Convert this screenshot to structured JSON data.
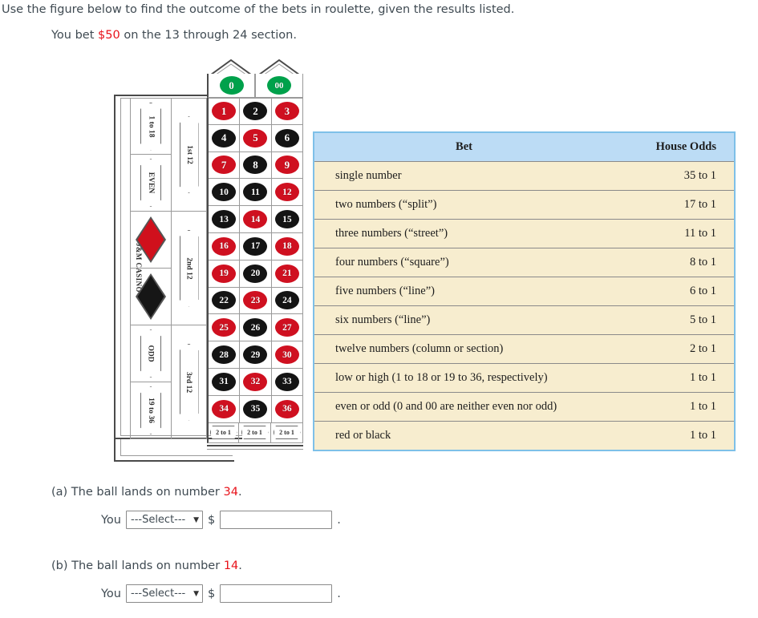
{
  "prompt": {
    "instruction": "Use the figure below to find the outcome of the bets in roulette, given the results listed.",
    "bet_prefix": "You bet ",
    "bet_amount": "$50",
    "bet_suffix": " on the 13 through 24 section.",
    "amount_color": "#e8121a"
  },
  "roulette": {
    "casino_name": "J&M CASINO",
    "zeros": [
      {
        "label": "0",
        "color": "green"
      },
      {
        "label": "00",
        "color": "green"
      }
    ],
    "numbers": [
      {
        "n": "1",
        "color": "red"
      },
      {
        "n": "2",
        "color": "black"
      },
      {
        "n": "3",
        "color": "red"
      },
      {
        "n": "4",
        "color": "black"
      },
      {
        "n": "5",
        "color": "red"
      },
      {
        "n": "6",
        "color": "black"
      },
      {
        "n": "7",
        "color": "red"
      },
      {
        "n": "8",
        "color": "black"
      },
      {
        "n": "9",
        "color": "red"
      },
      {
        "n": "10",
        "color": "black"
      },
      {
        "n": "11",
        "color": "black"
      },
      {
        "n": "12",
        "color": "red"
      },
      {
        "n": "13",
        "color": "black"
      },
      {
        "n": "14",
        "color": "red"
      },
      {
        "n": "15",
        "color": "black"
      },
      {
        "n": "16",
        "color": "red"
      },
      {
        "n": "17",
        "color": "black"
      },
      {
        "n": "18",
        "color": "red"
      },
      {
        "n": "19",
        "color": "red"
      },
      {
        "n": "20",
        "color": "black"
      },
      {
        "n": "21",
        "color": "red"
      },
      {
        "n": "22",
        "color": "black"
      },
      {
        "n": "23",
        "color": "red"
      },
      {
        "n": "24",
        "color": "black"
      },
      {
        "n": "25",
        "color": "red"
      },
      {
        "n": "26",
        "color": "black"
      },
      {
        "n": "27",
        "color": "red"
      },
      {
        "n": "28",
        "color": "black"
      },
      {
        "n": "29",
        "color": "black"
      },
      {
        "n": "30",
        "color": "red"
      },
      {
        "n": "31",
        "color": "black"
      },
      {
        "n": "32",
        "color": "red"
      },
      {
        "n": "33",
        "color": "black"
      },
      {
        "n": "34",
        "color": "red"
      },
      {
        "n": "35",
        "color": "black"
      },
      {
        "n": "36",
        "color": "red"
      }
    ],
    "outside_bets": [
      {
        "label": "1 to 18",
        "kind": "text"
      },
      {
        "label": "EVEN",
        "kind": "text"
      },
      {
        "label": "red",
        "kind": "diamond-red"
      },
      {
        "label": "black",
        "kind": "diamond-black"
      },
      {
        "label": "ODD",
        "kind": "text"
      },
      {
        "label": "19 to 36",
        "kind": "text"
      }
    ],
    "dozens": [
      "1st 12",
      "2nd 12",
      "3rd 12"
    ],
    "column_bets": [
      "2 to 1",
      "2 to 1",
      "2 to 1"
    ],
    "colors": {
      "red": "#cf1020",
      "black": "#141414",
      "green": "#00a14b"
    }
  },
  "odds_table": {
    "headers": {
      "bet": "Bet",
      "odds": "House Odds"
    },
    "header_bg": "#bcdcf5",
    "body_bg": "#f7edcf",
    "border": "#7ec0e8",
    "rows": [
      {
        "bet": "single number",
        "odds": "35 to 1"
      },
      {
        "bet": "two numbers (“split”)",
        "odds": "17 to 1"
      },
      {
        "bet": "three numbers (“street”)",
        "odds": "11 to 1"
      },
      {
        "bet": "four numbers (“square”)",
        "odds": "8 to 1"
      },
      {
        "bet": "five numbers (“line”)",
        "odds": "6 to 1"
      },
      {
        "bet": "six numbers (“line”)",
        "odds": "5 to 1"
      },
      {
        "bet": "twelve numbers (column or section)",
        "odds": "2 to 1"
      },
      {
        "bet": "low or high (1 to 18 or 19 to 36, respectively)",
        "odds": "1 to 1"
      },
      {
        "bet": "even or odd (0 and 00 are neither even nor odd)",
        "odds": "1 to 1"
      },
      {
        "bet": "red or black",
        "odds": "1 to 1"
      }
    ]
  },
  "questions": [
    {
      "id": "a",
      "text_prefix": "(a) The ball lands on number ",
      "number": "34",
      "text_suffix": ".",
      "you_label": "You",
      "select_value": "---Select---",
      "dollar": "$",
      "amount_value": "",
      "amount_placeholder": "",
      "period": "."
    },
    {
      "id": "b",
      "text_prefix": "(b) The ball lands on number ",
      "number": "14",
      "text_suffix": ".",
      "you_label": "You",
      "select_value": "---Select---",
      "dollar": "$",
      "amount_value": "",
      "amount_placeholder": "",
      "period": "."
    }
  ]
}
